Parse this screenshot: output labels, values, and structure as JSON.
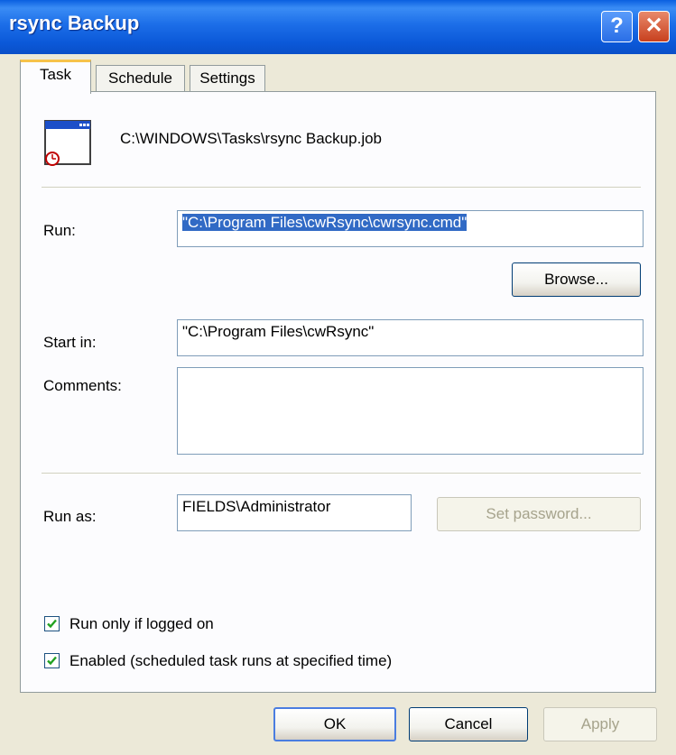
{
  "window": {
    "title": "rsync Backup",
    "accent": "#0a5fe0"
  },
  "tabs": [
    {
      "label": "Task",
      "active": true
    },
    {
      "label": "Schedule",
      "active": false
    },
    {
      "label": "Settings",
      "active": false
    }
  ],
  "task": {
    "icon": "scheduled-task-window-icon",
    "path": "C:\\WINDOWS\\Tasks\\rsync Backup.job"
  },
  "run": {
    "label": "Run:",
    "value": "\"C:\\Program Files\\cwRsync\\cwrsync.cmd\""
  },
  "browse_label": "Browse...",
  "start_in": {
    "label": "Start in:",
    "value": "\"C:\\Program Files\\cwRsync\""
  },
  "comments": {
    "label": "Comments:",
    "value": ""
  },
  "run_as": {
    "label": "Run as:",
    "value": "FIELDS\\Administrator"
  },
  "set_password_label": "Set password...",
  "checkboxes": [
    {
      "label": "Run only if logged on",
      "checked": true
    },
    {
      "label": "Enabled (scheduled task runs at specified time)",
      "checked": true
    }
  ],
  "buttons": {
    "ok": "OK",
    "cancel": "Cancel",
    "apply": "Apply"
  }
}
